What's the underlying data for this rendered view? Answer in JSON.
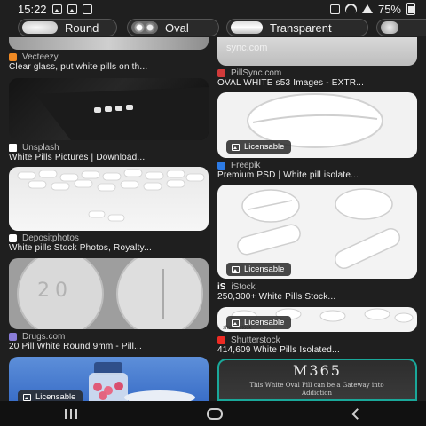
{
  "status_bar": {
    "time": "15:22",
    "battery": "75%"
  },
  "chips": [
    {
      "label": "Round"
    },
    {
      "label": "Oval"
    },
    {
      "label": "Transparent"
    }
  ],
  "left_column": [
    {
      "source": "Vecteezy",
      "title": "Clear glass, put white pills on th..."
    },
    {
      "source": "Unsplash",
      "title": "White Pills Pictures | Download..."
    },
    {
      "source": "Depositphotos",
      "title": "White pills Stock Photos, Royalty..."
    },
    {
      "source": "Drugs.com",
      "title": "20 Pill White Round 9mm - Pill...",
      "image_text": "20"
    },
    {
      "badge": "Licensable"
    }
  ],
  "right_column": [
    {
      "source": "PillSync.com",
      "title": "OVAL WHITE s53 Images - EXTR...",
      "watermark": "sync.com"
    },
    {
      "source": "Freepik",
      "title": "Premium PSD | White pill isolate...",
      "badge": "Licensable"
    },
    {
      "source": "iStock",
      "title": "250,300+ White Pills Stock...",
      "badge": "Licensable"
    },
    {
      "source": "Shutterstock",
      "title": "414,609 White Pills Isolated...",
      "badge": "Licensable",
      "watermark": "shutterstock"
    },
    {
      "image_text_main": "M365",
      "image_text_sub": "This White Oval Pill can be a Gateway into Addiction"
    }
  ],
  "colors": {
    "background": "#1f1f1f",
    "vecteezy": "#f08a24",
    "unsplash": "#ffffff",
    "depositphotos": "#ffffff",
    "drugs": "#8a7dd8",
    "pillsync": "#d13a3a",
    "freepik": "#2d7be5",
    "istock": "#ffffff",
    "shutterstock": "#ee2b24"
  }
}
